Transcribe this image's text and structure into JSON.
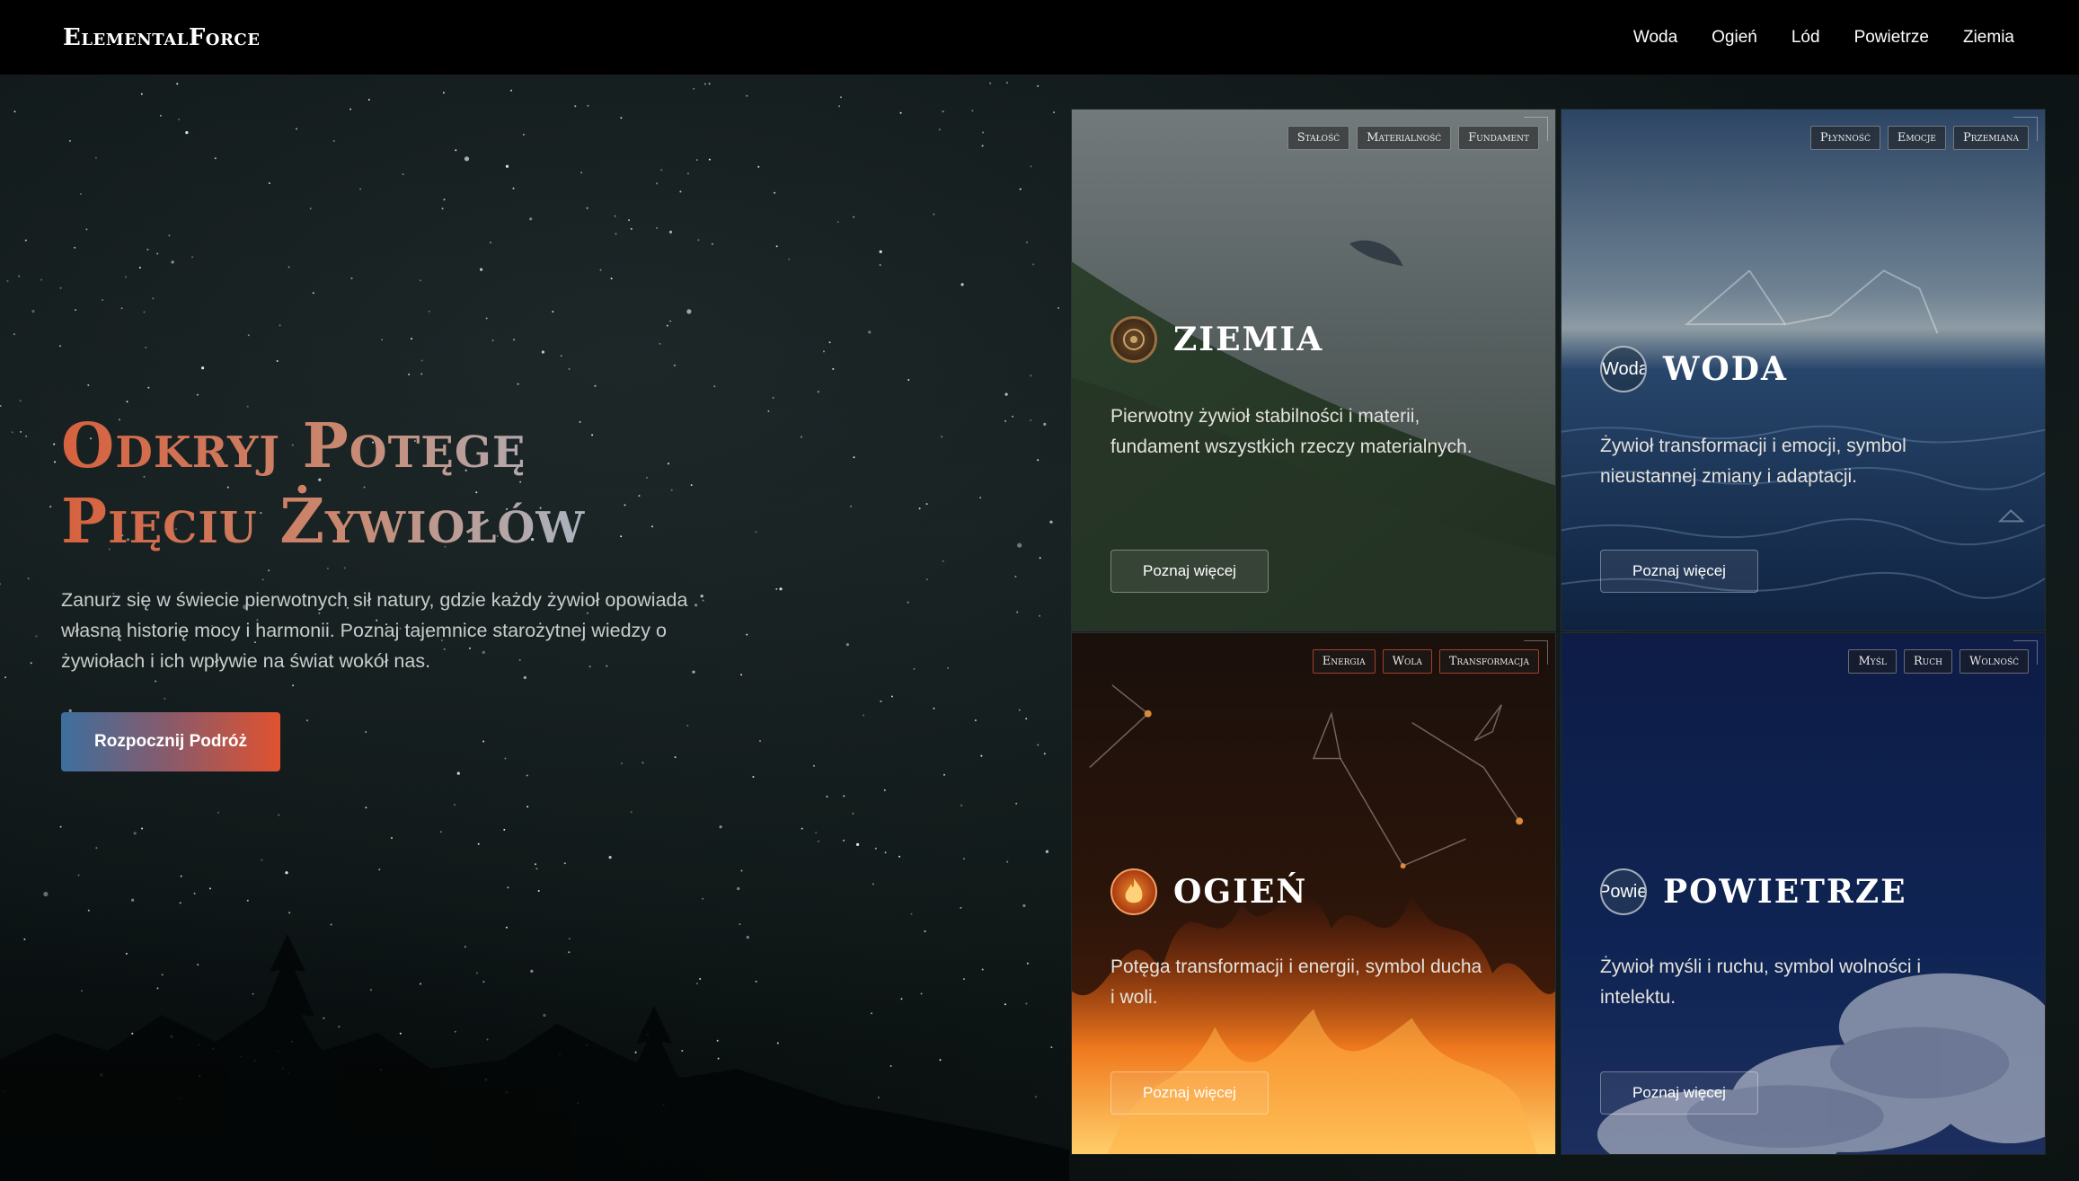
{
  "brand": {
    "logo": "ElementalForce"
  },
  "nav": {
    "links": [
      "Woda",
      "Ogień",
      "Lód",
      "Powietrze",
      "Ziemia"
    ]
  },
  "hero": {
    "title_line1": "Odkryj Potęgę",
    "title_line2": "Pięciu Żywiołów",
    "text": "Zanurz się w świecie pierwotnych sił natury, gdzie każdy żywioł opowiada własną historię mocy i harmonii. Poznaj tajemnice starożytnej wiedzy o żywiołach i ich wpływie na świat wokół nas.",
    "cta": "Rozpocznij Podróż"
  },
  "cards": [
    {
      "title": "ZIEMIA",
      "tags": [
        "Stałość",
        "Materialność",
        "Fundament"
      ],
      "description": "Pierwotny żywioł stabilności i materii, fundament wszystkich rzeczy materialnych.",
      "button": "Poznaj więcej",
      "emblem": "earth-emblem-icon",
      "accent": "#8a6a3e"
    },
    {
      "title": "WODA",
      "tags": [
        "Płynność",
        "Emocje",
        "Przemiana"
      ],
      "description": "Żywioł transformacji i emocji, symbol nieustannej zmiany i adaptacji.",
      "button": "Poznaj więcej",
      "emblem": "Woda",
      "accent": "#3b5f8a"
    },
    {
      "title": "OGIEŃ",
      "tags": [
        "Energia",
        "Wola",
        "Transformacja"
      ],
      "description": "Potęga transformacji i energii, symbol ducha i woli.",
      "button": "Poznaj więcej",
      "emblem": "fire-emblem-icon",
      "accent": "#e0522f"
    },
    {
      "title": "POWIETRZE",
      "tags": [
        "Myśl",
        "Ruch",
        "Wolność"
      ],
      "description": "Żywioł myśli i ruchu, symbol wolności i intelektu.",
      "button": "Poznaj więcej",
      "emblem": "Powietrze",
      "accent": "#1a3368"
    }
  ]
}
